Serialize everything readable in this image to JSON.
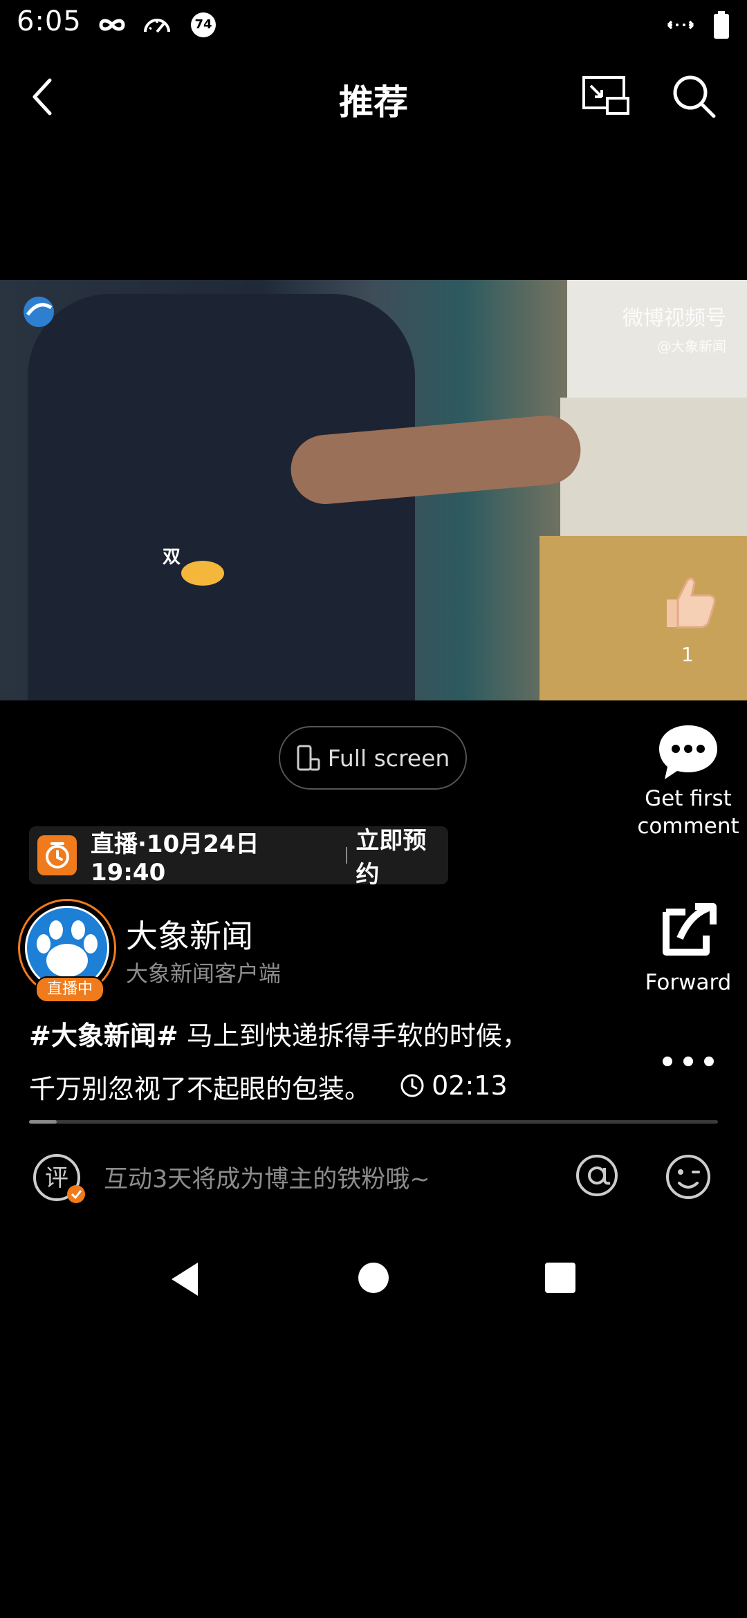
{
  "status_bar": {
    "time": "6:05",
    "icons_left": [
      "infinity-icon",
      "speed-gauge-icon",
      "notification-74-icon"
    ],
    "notification_badge": "74",
    "icons_right": [
      "data-transfer-icon",
      "battery-icon"
    ]
  },
  "header": {
    "title": "推荐",
    "back_icon": "chevron-left-icon",
    "pip_icon": "picture-in-picture-icon",
    "search_icon": "search-icon"
  },
  "video": {
    "watermark_main": "微博视频号",
    "watermark_sub": "@大象新闻",
    "bubble_text": "双",
    "like_count": "1"
  },
  "fullscreen": {
    "label": "Full screen"
  },
  "actions": {
    "comment_label_line1": "Get first",
    "comment_label_line2": "comment",
    "forward_label": "Forward"
  },
  "live_schedule": {
    "text": "直播·10月24日 19:40",
    "cta": "立即预约"
  },
  "author": {
    "name": "大象新闻",
    "subtitle": "大象新闻客户端",
    "live_badge": "直播中"
  },
  "post": {
    "hashtag": "#大象新闻#",
    "text_line1": " 马上到快递拆得手软的时候，",
    "text_line2": "千万别忽视了不起眼的包装。",
    "duration": "02:13"
  },
  "progress": {
    "played_fraction": 0.04
  },
  "comment_bar": {
    "placeholder": "互动3天将成为博主的铁粉哦~"
  },
  "colors": {
    "accent_orange": "#f07b1c",
    "background": "#000000",
    "muted_text": "#8c8c8c"
  }
}
